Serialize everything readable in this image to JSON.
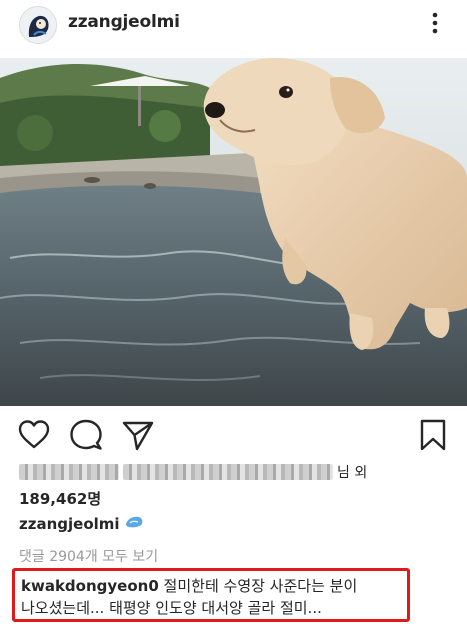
{
  "header": {
    "username": "zzangjeolmi",
    "more_icon": "more-vertical-icon"
  },
  "post": {
    "photo_icon": "post-photo"
  },
  "actions": {
    "like_icon": "heart-icon",
    "comment_icon": "comment-icon",
    "share_icon": "send-icon",
    "save_icon": "bookmark-icon"
  },
  "likes": {
    "likers_suffix": "님 외",
    "count": "189,462명"
  },
  "caption": {
    "username": "zzangjeolmi",
    "emoji_icon": "water-drop-emoji-icon"
  },
  "comments": {
    "view_all": "댓글 2904개 모두 보기",
    "highlighted": {
      "username": "kwakdongyeon0",
      "line1": "절미한테 수영장 사준다는 분이",
      "line2": "나오셨는데... 태평양 인도양 대서양 골라 절미..."
    },
    "highlight_color": "#e0191b"
  }
}
